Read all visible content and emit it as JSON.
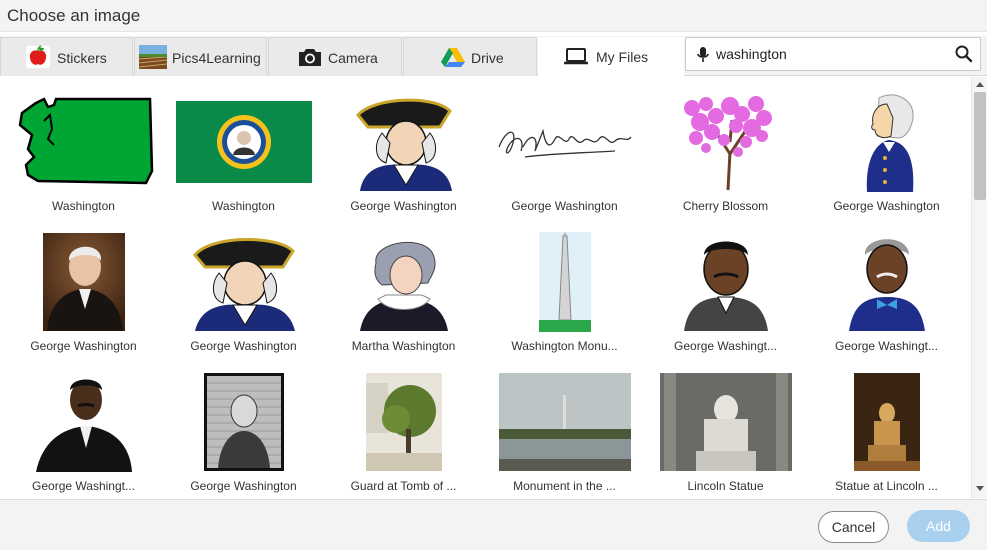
{
  "dialog": {
    "title": "Choose an image"
  },
  "tabs": [
    {
      "label": "Stickers",
      "icon": "apple-icon"
    },
    {
      "label": "Pics4Learning",
      "icon": "pics4learning-icon"
    },
    {
      "label": "Camera",
      "icon": "camera-icon"
    },
    {
      "label": "Drive",
      "icon": "drive-icon"
    },
    {
      "label": "My Files",
      "icon": "laptop-icon",
      "active": true
    }
  ],
  "search": {
    "value": "washington",
    "mic_icon": "microphone-icon",
    "search_icon": "search-icon"
  },
  "results": [
    {
      "caption": "Washington",
      "image": "washington-state-map"
    },
    {
      "caption": "Washington",
      "image": "washington-state-flag"
    },
    {
      "caption": "George Washington",
      "image": "george-washington-cartoon-hat"
    },
    {
      "caption": "George Washington",
      "image": "george-washington-signature"
    },
    {
      "caption": "Cherry Blossom",
      "image": "cherry-blossom-tree"
    },
    {
      "caption": "George Washington",
      "image": "george-washington-profile-cartoon"
    },
    {
      "caption": "George Washington",
      "image": "george-washington-portrait-painting"
    },
    {
      "caption": "George Washington",
      "image": "george-washington-cartoon-hat"
    },
    {
      "caption": "Martha Washington",
      "image": "martha-washington-cartoon"
    },
    {
      "caption": "Washington Monu...",
      "image": "washington-monument-cartoon"
    },
    {
      "caption": "George Washingt...",
      "image": "george-washington-carver-cartoon"
    },
    {
      "caption": "George Washingt...",
      "image": "george-washington-carver-cartoon-2"
    },
    {
      "caption": "George Washingt...",
      "image": "george-washington-carver-3d"
    },
    {
      "caption": "George Washington",
      "image": "george-washington-engraving"
    },
    {
      "caption": "Guard at Tomb of ...",
      "image": "guard-at-tomb-photo"
    },
    {
      "caption": "Monument in the ...",
      "image": "monument-photo"
    },
    {
      "caption": "Lincoln Statue",
      "image": "lincoln-statue-photo"
    },
    {
      "caption": "Statue at Lincoln ...",
      "image": "lincoln-memorial-statue-photo"
    }
  ],
  "footer": {
    "cancel_label": "Cancel",
    "add_label": "Add"
  },
  "colors": {
    "accent_disabled": "#a9d1ef",
    "washington_green": "#009b2e"
  }
}
